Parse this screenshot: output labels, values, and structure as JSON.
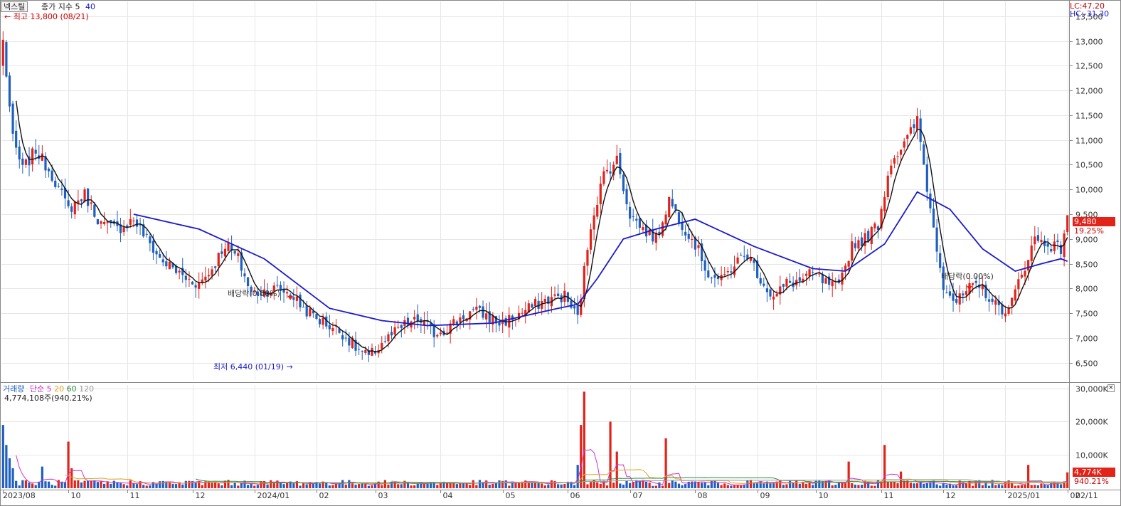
{
  "header": {
    "stock_name": "넥스틸",
    "indicator_label": "종가 지수",
    "ma_short": "5",
    "ma_long": "40",
    "high_marker": "최고 13,800 (08/21)",
    "low_marker": "최저 6,440 (01/19)",
    "lc_label": "LC:47.20",
    "hc_label": "HC:-31.30"
  },
  "price_axis": {
    "ticks": [
      "13,500",
      "13,000",
      "12,500",
      "12,000",
      "11,500",
      "11,000",
      "10,500",
      "10,000",
      "9,500",
      "9,000",
      "8,500",
      "8,000",
      "7,500",
      "7,000",
      "6,500"
    ],
    "current_price": "9,480",
    "current_change": "19.25%"
  },
  "dividend_labels": [
    "배당락(0.00%)",
    "배당락(0.00%)"
  ],
  "volume_panel": {
    "legend_title": "거래량",
    "legend_type": "단순",
    "legend_periods": [
      "5",
      "20",
      "60",
      "120"
    ],
    "current_volume": "4,774,108주(940.21%)",
    "axis_ticks": [
      "30,000K",
      "20,000K",
      "10,000K"
    ],
    "current_tag": "4,774K",
    "current_pct": "940.21%"
  },
  "x_axis": {
    "labels": [
      "2023/08",
      "10",
      "11",
      "12",
      "2024/01",
      "02",
      "03",
      "04",
      "05",
      "06",
      "07",
      "08",
      "09",
      "10",
      "11",
      "12",
      "2025/01",
      "02"
    ],
    "right_label": "02/11"
  },
  "colors": {
    "up": "#e2231a",
    "down": "#1f5fbf",
    "ma5": "#111111",
    "ma40": "#1a1acc",
    "vol5": "#cc33cc",
    "vol20": "#e0a020",
    "vol60": "#2e8b3a",
    "vol120": "#999999"
  },
  "chart_data": {
    "type": "candlestick",
    "price_ylim": [
      6150,
      13800
    ],
    "volume_ylim": [
      0,
      31000
    ],
    "volume_unit": "K",
    "x_range": [
      "2023-08-21",
      "2025-02-11"
    ],
    "month_markers": [
      "2023-08",
      "2023-10",
      "2023-11",
      "2023-12",
      "2024-01",
      "2024-02",
      "2024-03",
      "2024-04",
      "2024-05",
      "2024-06",
      "2024-07",
      "2024-08",
      "2024-09",
      "2024-10",
      "2024-11",
      "2024-12",
      "2025-01",
      "2025-02"
    ],
    "series_close": [
      [
        0,
        13000
      ],
      [
        3,
        11000
      ],
      [
        6,
        10400
      ],
      [
        10,
        10800
      ],
      [
        15,
        10300
      ],
      [
        20,
        9600
      ],
      [
        25,
        9900
      ],
      [
        30,
        9300
      ],
      [
        35,
        9200
      ],
      [
        40,
        9400
      ],
      [
        44,
        9000
      ],
      [
        48,
        8600
      ],
      [
        52,
        8400
      ],
      [
        56,
        8200
      ],
      [
        60,
        8100
      ],
      [
        64,
        8400
      ],
      [
        68,
        8900
      ],
      [
        72,
        8600
      ],
      [
        76,
        7900
      ],
      [
        80,
        7950
      ],
      [
        84,
        8000
      ],
      [
        88,
        7900
      ],
      [
        92,
        7600
      ],
      [
        96,
        7400
      ],
      [
        100,
        7250
      ],
      [
        104,
        7100
      ],
      [
        108,
        6800
      ],
      [
        112,
        6600
      ],
      [
        116,
        6900
      ],
      [
        120,
        7100
      ],
      [
        124,
        7300
      ],
      [
        128,
        7350
      ],
      [
        132,
        7100
      ],
      [
        136,
        7200
      ],
      [
        140,
        7400
      ],
      [
        144,
        7550
      ],
      [
        148,
        7450
      ],
      [
        152,
        7300
      ],
      [
        156,
        7400
      ],
      [
        160,
        7550
      ],
      [
        164,
        7700
      ],
      [
        168,
        7800
      ],
      [
        172,
        7850
      ],
      [
        176,
        7400
      ],
      [
        180,
        9300
      ],
      [
        184,
        10300
      ],
      [
        188,
        10600
      ],
      [
        192,
        9500
      ],
      [
        196,
        9200
      ],
      [
        200,
        9000
      ],
      [
        204,
        9800
      ],
      [
        208,
        9300
      ],
      [
        212,
        8900
      ],
      [
        216,
        8300
      ],
      [
        220,
        8150
      ],
      [
        224,
        8500
      ],
      [
        228,
        8700
      ],
      [
        232,
        8200
      ],
      [
        236,
        7800
      ],
      [
        240,
        8100
      ],
      [
        244,
        8150
      ],
      [
        248,
        8300
      ],
      [
        252,
        8100
      ],
      [
        256,
        8000
      ],
      [
        260,
        8900
      ],
      [
        264,
        9000
      ],
      [
        268,
        9300
      ],
      [
        272,
        10600
      ],
      [
        276,
        10900
      ],
      [
        280,
        11400
      ],
      [
        284,
        9600
      ],
      [
        288,
        8100
      ],
      [
        292,
        7700
      ],
      [
        296,
        8000
      ],
      [
        300,
        8000
      ],
      [
        304,
        7650
      ],
      [
        308,
        7550
      ],
      [
        312,
        8300
      ],
      [
        316,
        9000
      ],
      [
        320,
        8900
      ],
      [
        324,
        8800
      ],
      [
        326,
        9480
      ]
    ],
    "series_ma40": [
      [
        40,
        9500
      ],
      [
        60,
        9200
      ],
      [
        80,
        8600
      ],
      [
        100,
        7600
      ],
      [
        116,
        7350
      ],
      [
        130,
        7250
      ],
      [
        150,
        7300
      ],
      [
        170,
        7600
      ],
      [
        176,
        7680
      ],
      [
        182,
        8200
      ],
      [
        190,
        9000
      ],
      [
        200,
        9200
      ],
      [
        212,
        9400
      ],
      [
        230,
        8850
      ],
      [
        248,
        8400
      ],
      [
        258,
        8350
      ],
      [
        270,
        8900
      ],
      [
        280,
        9950
      ],
      [
        290,
        9600
      ],
      [
        300,
        8800
      ],
      [
        310,
        8350
      ],
      [
        318,
        8500
      ],
      [
        324,
        8600
      ],
      [
        326,
        8550
      ]
    ],
    "volume_bars": [
      {
        "i": 0,
        "v": 19000,
        "dir": "down"
      },
      {
        "i": 1,
        "v": 13000,
        "dir": "down"
      },
      {
        "i": 2,
        "v": 9000,
        "dir": "down"
      },
      {
        "i": 3,
        "v": 6000,
        "dir": "down"
      },
      {
        "i": 20,
        "v": 14000,
        "dir": "up"
      },
      {
        "i": 21,
        "v": 6000,
        "dir": "up"
      },
      {
        "i": 12,
        "v": 6500,
        "dir": "down"
      },
      {
        "i": 176,
        "v": 7000,
        "dir": "down"
      },
      {
        "i": 178,
        "v": 29000,
        "dir": "up"
      },
      {
        "i": 177,
        "v": 19000,
        "dir": "up"
      },
      {
        "i": 186,
        "v": 20000,
        "dir": "up"
      },
      {
        "i": 188,
        "v": 11000,
        "dir": "up"
      },
      {
        "i": 203,
        "v": 15000,
        "dir": "up"
      },
      {
        "i": 259,
        "v": 8000,
        "dir": "up"
      },
      {
        "i": 270,
        "v": 13000,
        "dir": "up"
      },
      {
        "i": 275,
        "v": 5000,
        "dir": "up"
      },
      {
        "i": 314,
        "v": 7000,
        "dir": "up"
      },
      {
        "i": 326,
        "v": 4774,
        "dir": "up"
      }
    ]
  }
}
